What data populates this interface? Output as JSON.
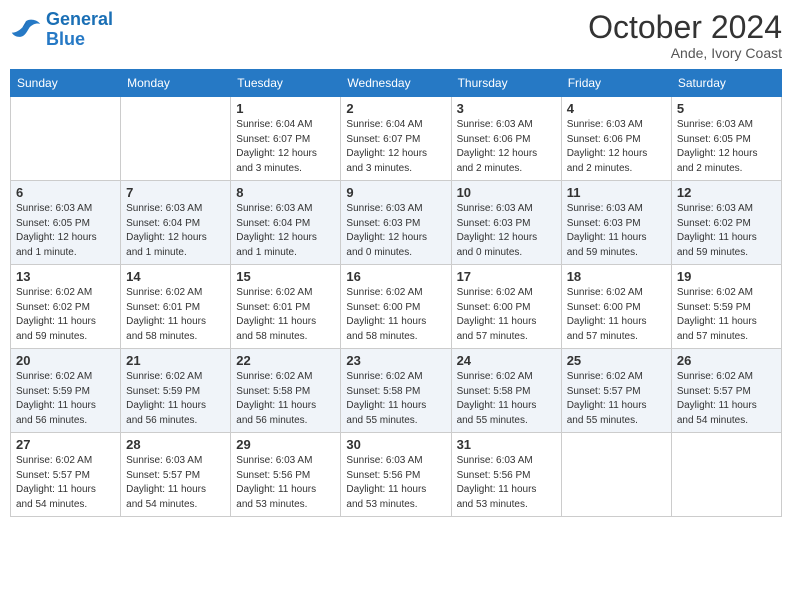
{
  "logo": {
    "text_general": "General",
    "text_blue": "Blue"
  },
  "title": "October 2024",
  "location": "Ande, Ivory Coast",
  "days_of_week": [
    "Sunday",
    "Monday",
    "Tuesday",
    "Wednesday",
    "Thursday",
    "Friday",
    "Saturday"
  ],
  "weeks": [
    [
      {
        "day": "",
        "info": ""
      },
      {
        "day": "",
        "info": ""
      },
      {
        "day": "1",
        "info": "Sunrise: 6:04 AM\nSunset: 6:07 PM\nDaylight: 12 hours and 3 minutes."
      },
      {
        "day": "2",
        "info": "Sunrise: 6:04 AM\nSunset: 6:07 PM\nDaylight: 12 hours and 3 minutes."
      },
      {
        "day": "3",
        "info": "Sunrise: 6:03 AM\nSunset: 6:06 PM\nDaylight: 12 hours and 2 minutes."
      },
      {
        "day": "4",
        "info": "Sunrise: 6:03 AM\nSunset: 6:06 PM\nDaylight: 12 hours and 2 minutes."
      },
      {
        "day": "5",
        "info": "Sunrise: 6:03 AM\nSunset: 6:05 PM\nDaylight: 12 hours and 2 minutes."
      }
    ],
    [
      {
        "day": "6",
        "info": "Sunrise: 6:03 AM\nSunset: 6:05 PM\nDaylight: 12 hours and 1 minute."
      },
      {
        "day": "7",
        "info": "Sunrise: 6:03 AM\nSunset: 6:04 PM\nDaylight: 12 hours and 1 minute."
      },
      {
        "day": "8",
        "info": "Sunrise: 6:03 AM\nSunset: 6:04 PM\nDaylight: 12 hours and 1 minute."
      },
      {
        "day": "9",
        "info": "Sunrise: 6:03 AM\nSunset: 6:03 PM\nDaylight: 12 hours and 0 minutes."
      },
      {
        "day": "10",
        "info": "Sunrise: 6:03 AM\nSunset: 6:03 PM\nDaylight: 12 hours and 0 minutes."
      },
      {
        "day": "11",
        "info": "Sunrise: 6:03 AM\nSunset: 6:03 PM\nDaylight: 11 hours and 59 minutes."
      },
      {
        "day": "12",
        "info": "Sunrise: 6:03 AM\nSunset: 6:02 PM\nDaylight: 11 hours and 59 minutes."
      }
    ],
    [
      {
        "day": "13",
        "info": "Sunrise: 6:02 AM\nSunset: 6:02 PM\nDaylight: 11 hours and 59 minutes."
      },
      {
        "day": "14",
        "info": "Sunrise: 6:02 AM\nSunset: 6:01 PM\nDaylight: 11 hours and 58 minutes."
      },
      {
        "day": "15",
        "info": "Sunrise: 6:02 AM\nSunset: 6:01 PM\nDaylight: 11 hours and 58 minutes."
      },
      {
        "day": "16",
        "info": "Sunrise: 6:02 AM\nSunset: 6:00 PM\nDaylight: 11 hours and 58 minutes."
      },
      {
        "day": "17",
        "info": "Sunrise: 6:02 AM\nSunset: 6:00 PM\nDaylight: 11 hours and 57 minutes."
      },
      {
        "day": "18",
        "info": "Sunrise: 6:02 AM\nSunset: 6:00 PM\nDaylight: 11 hours and 57 minutes."
      },
      {
        "day": "19",
        "info": "Sunrise: 6:02 AM\nSunset: 5:59 PM\nDaylight: 11 hours and 57 minutes."
      }
    ],
    [
      {
        "day": "20",
        "info": "Sunrise: 6:02 AM\nSunset: 5:59 PM\nDaylight: 11 hours and 56 minutes."
      },
      {
        "day": "21",
        "info": "Sunrise: 6:02 AM\nSunset: 5:59 PM\nDaylight: 11 hours and 56 minutes."
      },
      {
        "day": "22",
        "info": "Sunrise: 6:02 AM\nSunset: 5:58 PM\nDaylight: 11 hours and 56 minutes."
      },
      {
        "day": "23",
        "info": "Sunrise: 6:02 AM\nSunset: 5:58 PM\nDaylight: 11 hours and 55 minutes."
      },
      {
        "day": "24",
        "info": "Sunrise: 6:02 AM\nSunset: 5:58 PM\nDaylight: 11 hours and 55 minutes."
      },
      {
        "day": "25",
        "info": "Sunrise: 6:02 AM\nSunset: 5:57 PM\nDaylight: 11 hours and 55 minutes."
      },
      {
        "day": "26",
        "info": "Sunrise: 6:02 AM\nSunset: 5:57 PM\nDaylight: 11 hours and 54 minutes."
      }
    ],
    [
      {
        "day": "27",
        "info": "Sunrise: 6:02 AM\nSunset: 5:57 PM\nDaylight: 11 hours and 54 minutes."
      },
      {
        "day": "28",
        "info": "Sunrise: 6:03 AM\nSunset: 5:57 PM\nDaylight: 11 hours and 54 minutes."
      },
      {
        "day": "29",
        "info": "Sunrise: 6:03 AM\nSunset: 5:56 PM\nDaylight: 11 hours and 53 minutes."
      },
      {
        "day": "30",
        "info": "Sunrise: 6:03 AM\nSunset: 5:56 PM\nDaylight: 11 hours and 53 minutes."
      },
      {
        "day": "31",
        "info": "Sunrise: 6:03 AM\nSunset: 5:56 PM\nDaylight: 11 hours and 53 minutes."
      },
      {
        "day": "",
        "info": ""
      },
      {
        "day": "",
        "info": ""
      }
    ]
  ]
}
